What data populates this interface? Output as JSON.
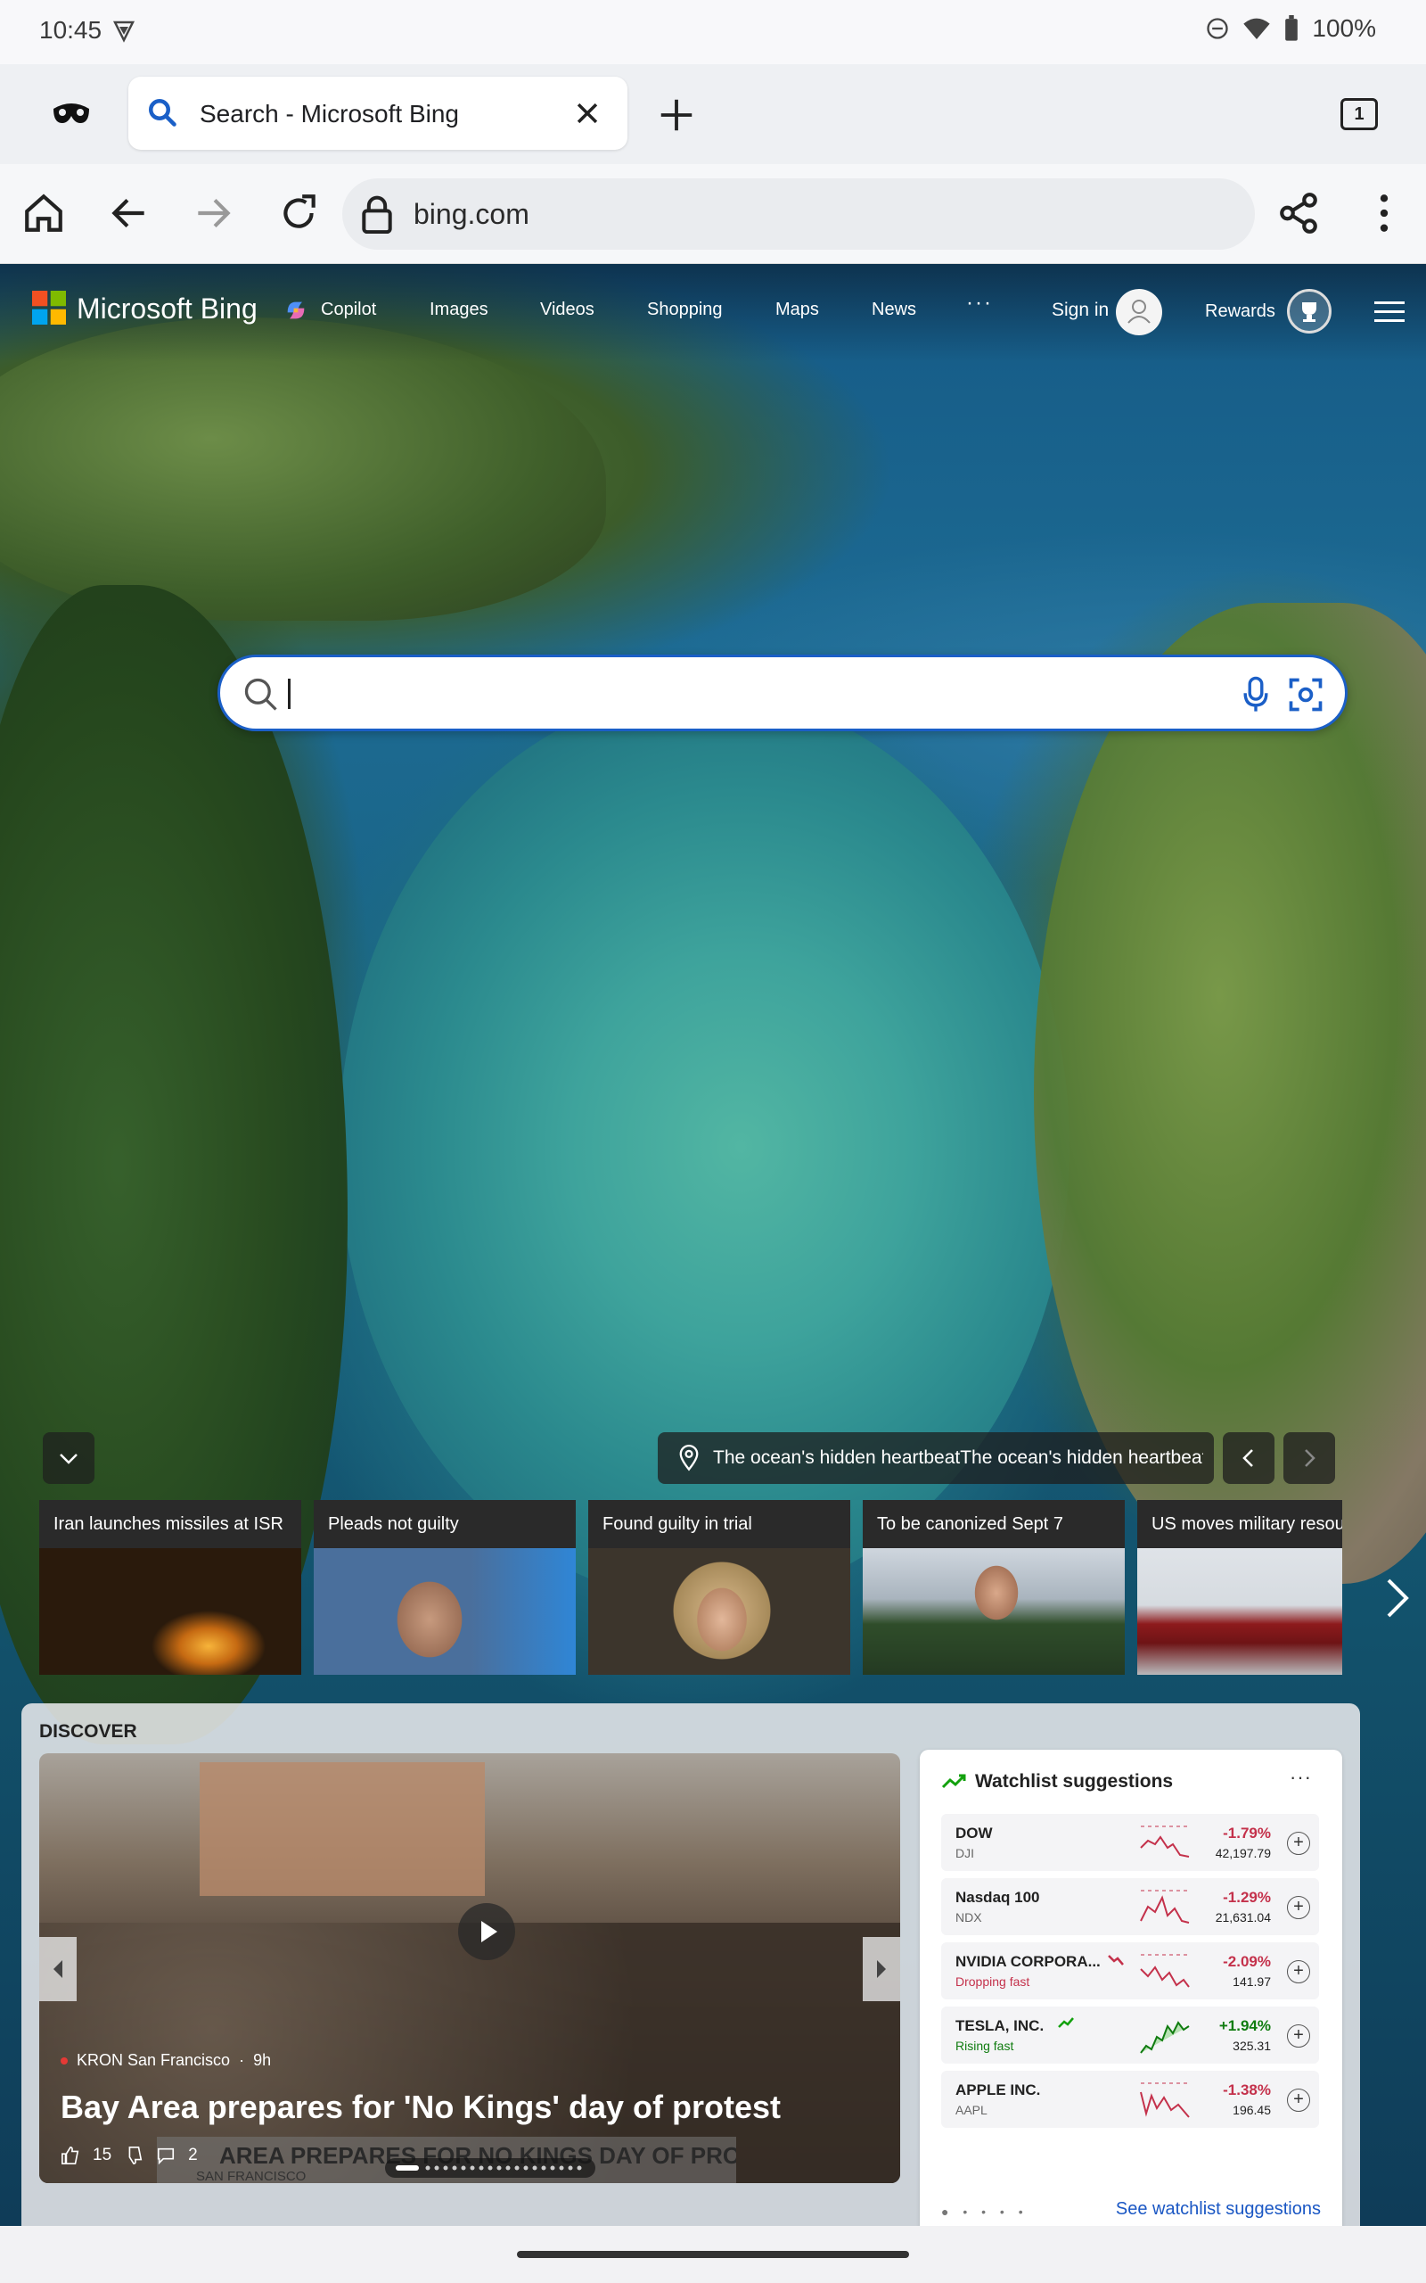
{
  "status_bar": {
    "time": "10:45",
    "battery": "100%"
  },
  "browser": {
    "tab_title": "Search - Microsoft Bing",
    "tab_count": "1",
    "url": "bing.com"
  },
  "bing": {
    "logo_text": "Microsoft Bing",
    "nav": [
      "Copilot",
      "Images",
      "Videos",
      "Shopping",
      "Maps",
      "News"
    ],
    "more": "···",
    "sign_in": "Sign in",
    "rewards": "Rewards",
    "search_value": ""
  },
  "carousel": {
    "caption": "The ocean's hidden heartbeatThe ocean's hidden heartbeat",
    "cards": [
      {
        "title": "Iran launches missiles at ISR"
      },
      {
        "title": "Pleads not guilty"
      },
      {
        "title": "Found guilty in trial"
      },
      {
        "title": "To be canonized Sept 7"
      },
      {
        "title": "US moves military resou"
      }
    ]
  },
  "discover": {
    "label": "DISCOVER",
    "video": {
      "source": "KRON San Francisco",
      "age": "9h",
      "headline": "Bay Area prepares for 'No Kings' day of protest",
      "likes": "15",
      "comments": "2",
      "overlay_text": "AREA PREPARES FOR NO KINGS DAY OF PROTEST",
      "overlay_sub": "SAN FRANCISCO"
    },
    "watchlist": {
      "title": "Watchlist suggestions",
      "more": "···",
      "link": "See watchlist suggestions",
      "stocks": [
        {
          "name": "DOW",
          "sub": "DJI",
          "change": "-1.79%",
          "price": "42,197.79",
          "dir": "down",
          "color": "#c4314b"
        },
        {
          "name": "Nasdaq 100",
          "sub": "NDX",
          "change": "-1.29%",
          "price": "21,631.04",
          "dir": "down",
          "color": "#c4314b"
        },
        {
          "name": "NVIDIA CORPORA...",
          "sub": "Dropping fast",
          "change": "-2.09%",
          "price": "141.97",
          "dir": "down",
          "color": "#c4314b"
        },
        {
          "name": "TESLA, INC.",
          "sub": "Rising fast",
          "change": "+1.94%",
          "price": "325.31",
          "dir": "up",
          "color": "#107c10"
        },
        {
          "name": "APPLE INC.",
          "sub": "AAPL",
          "change": "-1.38%",
          "price": "196.45",
          "dir": "down",
          "color": "#c4314b"
        }
      ]
    }
  },
  "colors": {
    "accent_blue": "#1b5fc7",
    "down_red": "#c4314b",
    "up_green": "#107c10"
  }
}
